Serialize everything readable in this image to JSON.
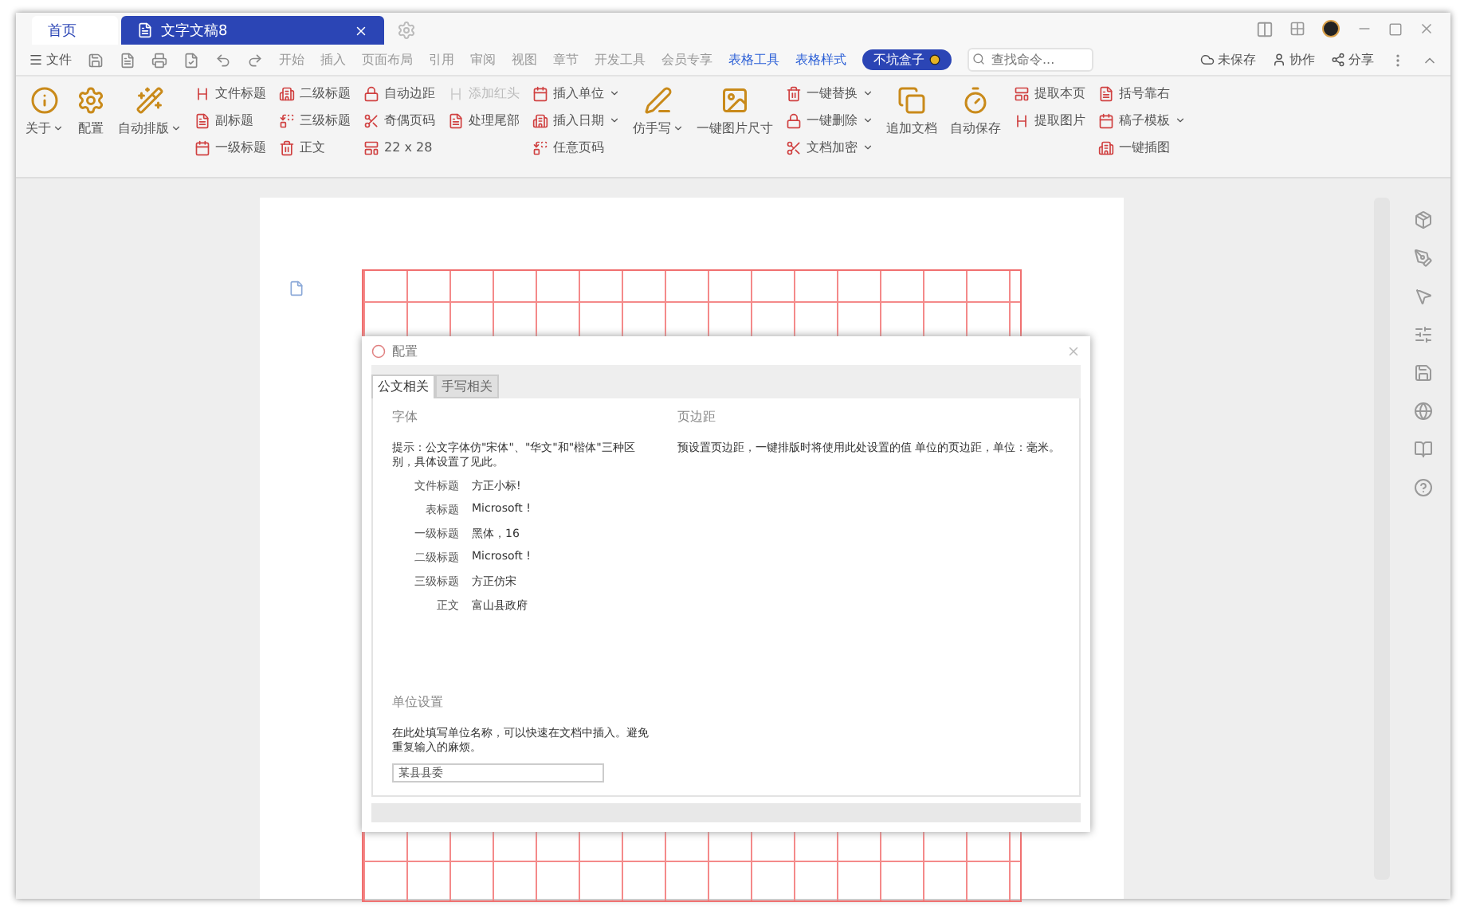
{
  "tabs": [
    {
      "label": "首页",
      "selected": false,
      "kind": "home"
    },
    {
      "label": "文字文稿8",
      "selected": true,
      "kind": "doc"
    }
  ],
  "menu": {
    "file": "文件",
    "items": [
      {
        "label": "开始",
        "kind": "plain"
      },
      {
        "label": "插入",
        "kind": "plain"
      },
      {
        "label": "页面布局",
        "kind": "plain"
      },
      {
        "label": "引用",
        "kind": "plain"
      },
      {
        "label": "审阅",
        "kind": "plain"
      },
      {
        "label": "视图",
        "kind": "plain"
      },
      {
        "label": "章节",
        "kind": "plain"
      },
      {
        "label": "开发工具",
        "kind": "plain"
      },
      {
        "label": "会员专享",
        "kind": "plain"
      },
      {
        "label": "表格工具",
        "kind": "accent"
      },
      {
        "label": "表格样式",
        "kind": "accent"
      },
      {
        "label": "不坑盒子",
        "kind": "pill"
      }
    ],
    "search": {
      "placeholder": "查找命令..."
    },
    "actions": [
      "未保存",
      "协作",
      "分享"
    ]
  },
  "ribbon": [
    {
      "kind": "large",
      "items": [
        {
          "label": "关于",
          "dropdown": true,
          "disabled": false
        },
        {
          "label": "配置",
          "dropdown": false,
          "disabled": false
        }
      ]
    },
    {
      "kind": "large",
      "items": [
        {
          "label": "自动排版",
          "dropdown": true,
          "disabled": false
        }
      ]
    },
    {
      "kind": "column",
      "items": [
        {
          "label": "文件标题",
          "dropdown": false,
          "disabled": false
        },
        {
          "label": "副标题",
          "dropdown": false,
          "disabled": false
        },
        {
          "label": "一级标题",
          "dropdown": false,
          "disabled": false
        }
      ]
    },
    {
      "kind": "column",
      "items": [
        {
          "label": "二级标题",
          "dropdown": false,
          "disabled": false
        },
        {
          "label": "三级标题",
          "dropdown": false,
          "disabled": false
        },
        {
          "label": "正文",
          "dropdown": false,
          "disabled": false
        }
      ]
    },
    {
      "kind": "column",
      "items": [
        {
          "label": "自动边距",
          "dropdown": false,
          "disabled": false
        },
        {
          "label": "奇偶页码",
          "dropdown": false,
          "disabled": false
        },
        {
          "label": "22 x 28",
          "dropdown": false,
          "disabled": false
        }
      ]
    },
    {
      "kind": "column",
      "items": [
        {
          "label": "添加红头",
          "dropdown": false,
          "disabled": true
        },
        {
          "label": "处理尾部",
          "dropdown": false,
          "disabled": false
        }
      ]
    },
    {
      "kind": "column",
      "items": [
        {
          "label": "插入单位",
          "dropdown": true,
          "disabled": false
        },
        {
          "label": "插入日期",
          "dropdown": true,
          "disabled": false
        },
        {
          "label": "任意页码",
          "dropdown": false,
          "disabled": false
        }
      ]
    },
    {
      "kind": "large",
      "items": [
        {
          "label": "仿手写",
          "dropdown": true,
          "disabled": false
        },
        {
          "label": "一键图片尺寸",
          "dropdown": false,
          "disabled": false
        }
      ]
    },
    {
      "kind": "column",
      "items": [
        {
          "label": "一键替换",
          "dropdown": true,
          "disabled": false
        },
        {
          "label": "一键删除",
          "dropdown": true,
          "disabled": false
        },
        {
          "label": "文档加密",
          "dropdown": true,
          "disabled": false
        }
      ]
    },
    {
      "kind": "large",
      "items": [
        {
          "label": "追加文档",
          "dropdown": false,
          "disabled": false
        },
        {
          "label": "自动保存",
          "dropdown": false,
          "disabled": false
        }
      ]
    },
    {
      "kind": "column",
      "items": [
        {
          "label": "提取本页",
          "dropdown": false,
          "disabled": false
        },
        {
          "label": "提取图片",
          "dropdown": false,
          "disabled": false
        }
      ]
    },
    {
      "kind": "column",
      "items": [
        {
          "label": "括号靠右",
          "dropdown": false,
          "disabled": false
        },
        {
          "label": "稿子模板",
          "dropdown": true,
          "disabled": false
        },
        {
          "label": "一键插图",
          "dropdown": false,
          "disabled": false
        }
      ]
    }
  ],
  "dialog": {
    "title": "配置",
    "tabs": [
      {
        "label": "公文相关",
        "selected": true
      },
      {
        "label": "手写相关",
        "selected": false
      }
    ],
    "sections": [
      {
        "kind": "fonts",
        "heading": "字体",
        "hint": "提示：公文字体仿\"宋体\"、\"华文\"和\"楷体\"三种区别，具体设置了见此。",
        "rows": [
          {
            "label": "文件标题",
            "value": "方正小标!"
          },
          {
            "label": "表标题",
            "value": "Microsoft !"
          },
          {
            "label": "一级标题",
            "value": "黑体，16"
          },
          {
            "label": "二级标题",
            "value": "Microsoft !"
          },
          {
            "label": "三级标题",
            "value": "方正仿宋"
          },
          {
            "label": "正文",
            "value": "富山县政府"
          }
        ]
      },
      {
        "kind": "margins",
        "heading": "页边距",
        "hint": "预设置页边距，一键排版时将使用此处设置的值 单位的页边距，单位：毫米。"
      },
      {
        "kind": "unit",
        "heading": "单位设置",
        "hint": "在此处填写单位名称，可以快速在文档中插入。避免重复输入的麻烦。",
        "input": {
          "value": "某县县委"
        }
      }
    ]
  }
}
